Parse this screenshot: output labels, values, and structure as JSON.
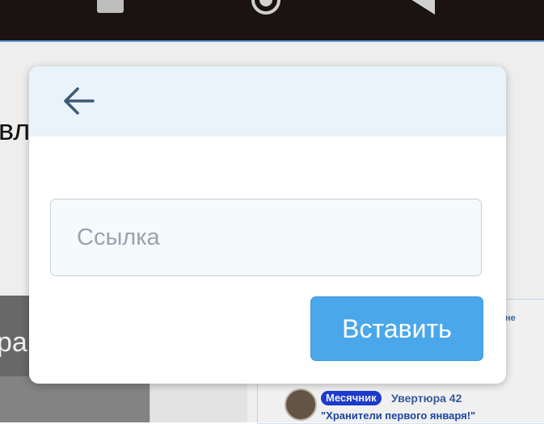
{
  "nav_bar": {
    "icons": [
      "recents-icon",
      "home-icon",
      "back-icon"
    ]
  },
  "background": {
    "heading_fragment": "вл",
    "photo_text_fragment": "ра",
    "card_note_fragment": "не",
    "badge": "Месячник",
    "author": "Увертюра 42",
    "quote": "\"Хранители первого января!\""
  },
  "dialog": {
    "back_icon": "arrow-left-icon",
    "link_input": {
      "value": "",
      "placeholder": "Ссылка"
    },
    "insert_button_label": "Вставить"
  },
  "colors": {
    "header_bg": "#e8f3fb",
    "accent": "#4aa8ea",
    "nav_bar_bg": "#1b1212"
  }
}
